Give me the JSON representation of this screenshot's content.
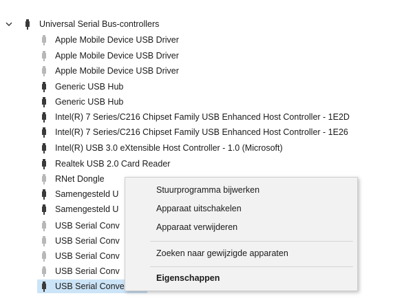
{
  "category": {
    "label": "Universal Serial Bus-controllers",
    "icon": "usb-icon",
    "expander_icon": "chevron-down-icon"
  },
  "devices": [
    {
      "label": "Apple Mobile Device USB Driver",
      "icon": "usb-icon-disabled"
    },
    {
      "label": "Apple Mobile Device USB Driver",
      "icon": "usb-icon-disabled"
    },
    {
      "label": "Apple Mobile Device USB Driver",
      "icon": "usb-icon-disabled"
    },
    {
      "label": "Generic USB Hub",
      "icon": "usb-icon"
    },
    {
      "label": "Generic USB Hub",
      "icon": "usb-icon"
    },
    {
      "label": "Intel(R) 7 Series/C216 Chipset Family USB Enhanced Host Controller - 1E2D",
      "icon": "usb-icon"
    },
    {
      "label": "Intel(R) 7 Series/C216 Chipset Family USB Enhanced Host Controller - 1E26",
      "icon": "usb-icon"
    },
    {
      "label": "Intel(R) USB 3.0 eXtensible Host Controller - 1.0 (Microsoft)",
      "icon": "usb-icon"
    },
    {
      "label": "Realtek USB 2.0 Card Reader",
      "icon": "usb-icon"
    },
    {
      "label": "RNet Dongle",
      "icon": "usb-icon-disabled"
    },
    {
      "label": "Samengesteld U",
      "icon": "usb-icon"
    },
    {
      "label": "Samengesteld U",
      "icon": "usb-icon"
    },
    {
      "label": "USB Serial Conv",
      "icon": "usb-icon-disabled"
    },
    {
      "label": "USB Serial Conv",
      "icon": "usb-icon-disabled"
    },
    {
      "label": "USB Serial Conv",
      "icon": "usb-icon-disabled"
    },
    {
      "label": "USB Serial Conv",
      "icon": "usb-icon-disabled"
    },
    {
      "label": "USB Serial Converter",
      "icon": "usb-icon",
      "selected": true
    }
  ],
  "context_menu": {
    "items": [
      {
        "label": "Stuurprogramma bijwerken"
      },
      {
        "label": "Apparaat uitschakelen"
      },
      {
        "label": "Apparaat verwijderen"
      },
      {
        "label": "Zoeken naar gewijzigde apparaten"
      },
      {
        "label": "Eigenschappen",
        "bold": true
      }
    ]
  },
  "colors": {
    "selection": "#cce4f7",
    "menu_background": "#f2f2f2",
    "icon_dark": "#3a3a3a",
    "icon_light": "#b8b8b8"
  }
}
